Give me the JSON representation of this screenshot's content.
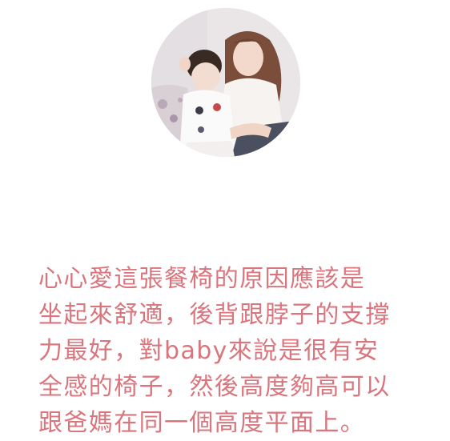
{
  "quote": {
    "lines": [
      "心心愛這張餐椅的原因應該是",
      "坐起來舒適，後背跟脖子的支撐",
      "力最好，對baby來說是很有安",
      "全感的椅子，然後高度夠高可以",
      "跟爸媽在同一個高度平面上。"
    ]
  },
  "colors": {
    "quote_text": "#d9757d",
    "background": "#ffffff"
  }
}
